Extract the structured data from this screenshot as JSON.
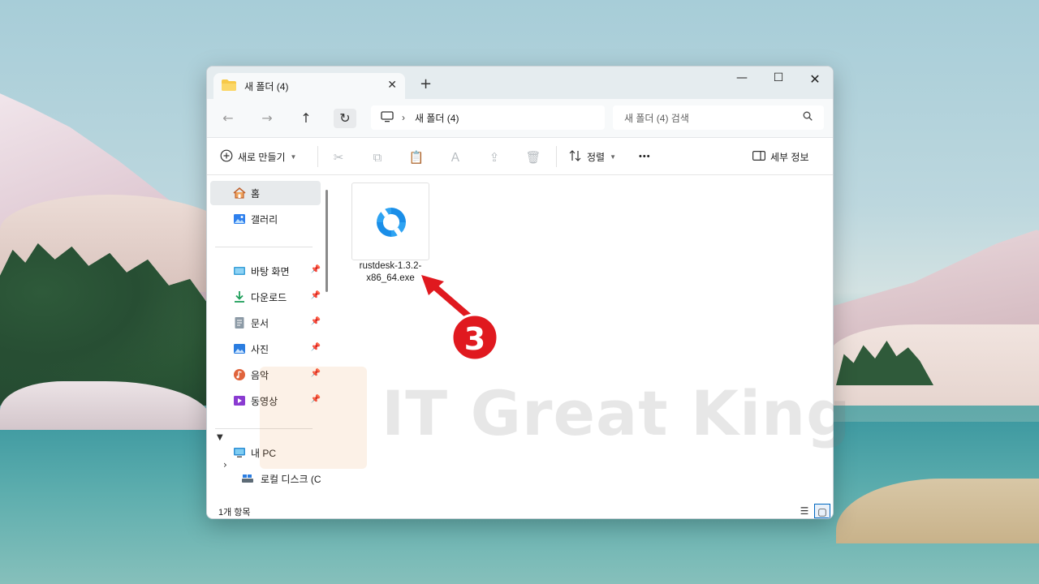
{
  "window": {
    "tab_title": "새 폴더 (4)",
    "tab_close": "✕",
    "new_tab": "+",
    "min": "—",
    "max": "☐",
    "close": "✕"
  },
  "nav": {
    "back": "←",
    "forward": "→",
    "up": "↑",
    "refresh": "↻",
    "separator": "›",
    "address": "새 폴더 (4)",
    "search_placeholder": "새 폴더 (4) 검색"
  },
  "commandbar": {
    "new_label": "새로 만들기",
    "sort_label": "정렬",
    "more": "•••",
    "details_label": "세부 정보"
  },
  "sidebar": {
    "items": [
      {
        "label": "홈"
      },
      {
        "label": "갤러리"
      },
      {
        "label": "바탕 화면"
      },
      {
        "label": "다운로드"
      },
      {
        "label": "문서"
      },
      {
        "label": "사진"
      },
      {
        "label": "음악"
      },
      {
        "label": "동영상"
      },
      {
        "label": "내 PC"
      },
      {
        "label": "로컬 디스크 (C"
      }
    ],
    "pin": "📌"
  },
  "content": {
    "file_name": "rustdesk-1.3.2-x86_64.exe",
    "watermark": "IT Great King",
    "step_number": "3"
  },
  "status": {
    "count": "1개 항목"
  },
  "colors": {
    "rustdesk_blue": "#1a8ee8",
    "callout_red": "#e0191f",
    "folder_yellow": "#f7c948",
    "selection_border": "#0067c0"
  }
}
